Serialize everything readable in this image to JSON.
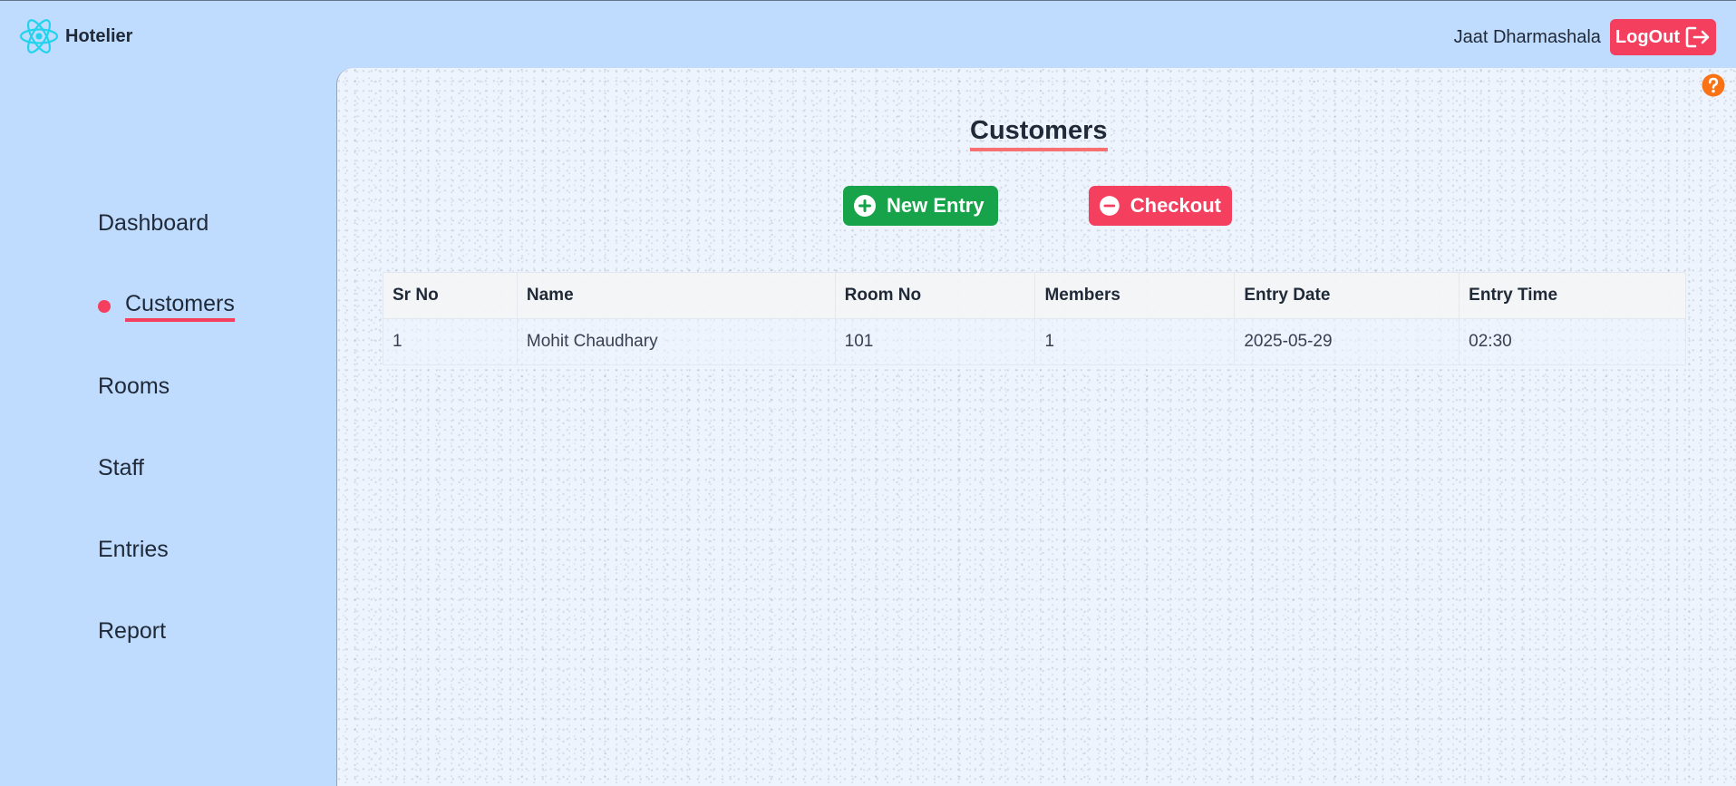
{
  "app": {
    "name": "Hotelier",
    "logo_icon": "react-atom-icon"
  },
  "header": {
    "user_name": "Jaat Dharmashala",
    "logout_label": "LogOut",
    "logout_icon": "logout-icon"
  },
  "sidebar": {
    "items": [
      {
        "label": "Dashboard",
        "active": false
      },
      {
        "label": "Customers",
        "active": true
      },
      {
        "label": "Rooms",
        "active": false
      },
      {
        "label": "Staff",
        "active": false
      },
      {
        "label": "Entries",
        "active": false
      },
      {
        "label": "Report",
        "active": false
      }
    ]
  },
  "main": {
    "title": "Customers",
    "new_entry_label": "New Entry",
    "checkout_label": "Checkout",
    "help_icon": "question-circle-icon"
  },
  "table": {
    "headers": [
      "Sr No",
      "Name",
      "Room No",
      "Members",
      "Entry Date",
      "Entry Time"
    ],
    "rows": [
      [
        "1",
        "Mohit Chaudhary",
        "101",
        "1",
        "2025-05-29",
        "02:30"
      ]
    ]
  },
  "colors": {
    "background": "#bfdbfe",
    "accent_red": "#f43f5e",
    "accent_green": "#16a34a",
    "help_orange": "#f97316"
  }
}
